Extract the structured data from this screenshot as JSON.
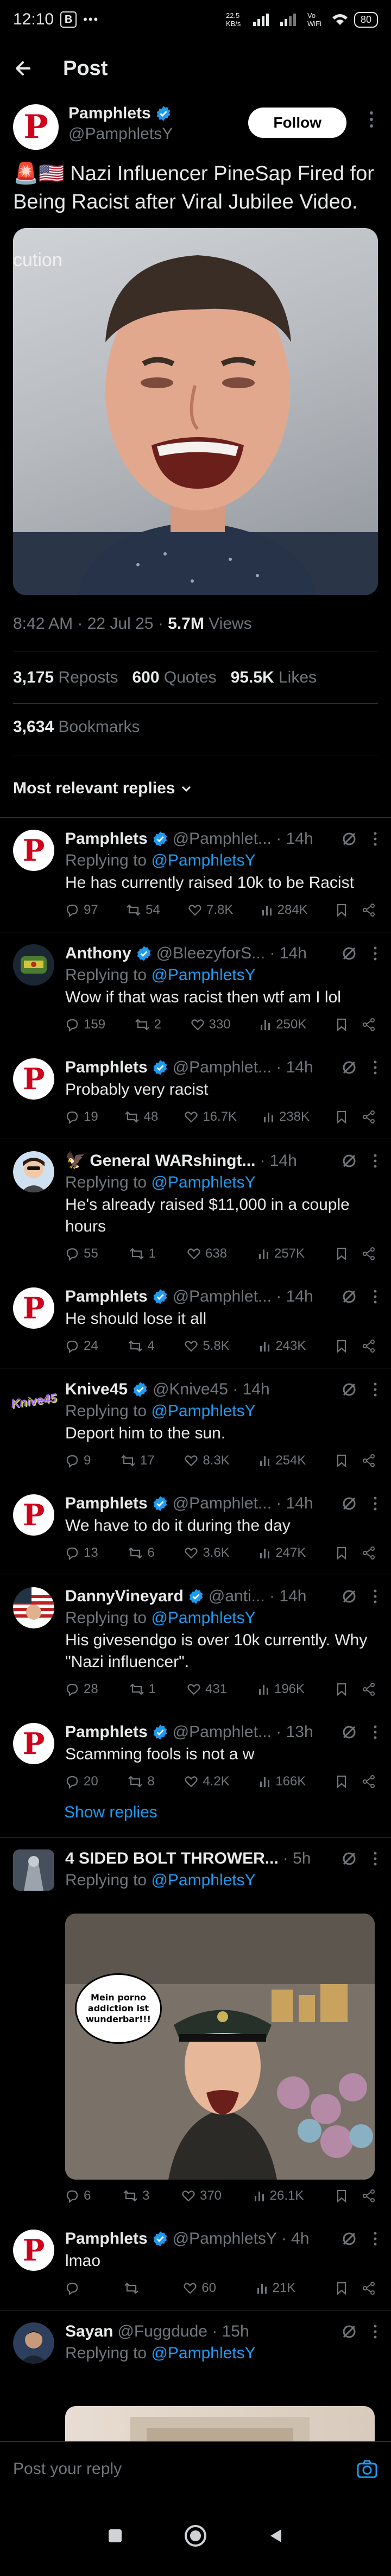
{
  "status_bar": {
    "time": "12:10",
    "speed": "22.5 KB/s",
    "network": "Vo WiFi",
    "battery": "80"
  },
  "header": {
    "title": "Post"
  },
  "post": {
    "author_name": "Pamphlets",
    "author_handle": "@PamphletsY",
    "follow_label": "Follow",
    "emoji": "🚨🇺🇸",
    "text": "Nazi Influencer PineSap Fired for Being Racist after Viral Jubilee Video.",
    "media_overlay_text": "cution",
    "time": "8:42 AM · 22 Jul 25 · ",
    "views_count": "5.7M",
    "views_label": " Views",
    "reposts_count": "3,175",
    "reposts_label": " Reposts",
    "quotes_count": "600",
    "quotes_label": " Quotes",
    "likes_count": "95.5K",
    "likes_label": " Likes",
    "bookmarks_count": "3,634",
    "bookmarks_label": " Bookmarks"
  },
  "sort_label": "Most relevant replies",
  "replies": [
    {
      "name": "Pamphlets",
      "rest": "@Pamphlet... · 14h",
      "replying_prefix": "Replying to ",
      "replying_to": "@PamphletsY",
      "text": "He has currently raised 10k to be Racist",
      "replies": "97",
      "reposts": "54",
      "likes": "7.8K",
      "views": "284K"
    },
    {
      "name": "Anthony",
      "rest": "@BleezyforS... · 14h",
      "replying_prefix": "Replying to ",
      "replying_to": "@PamphletsY",
      "text": "Wow if that was racist then wtf am I lol",
      "replies": "159",
      "reposts": "2",
      "likes": "330",
      "views": "250K"
    },
    {
      "name": "Pamphlets",
      "rest": "@Pamphlet... · 14h",
      "text": "Probably very racist",
      "replies": "19",
      "reposts": "48",
      "likes": "16.7K",
      "views": "238K"
    },
    {
      "name": "General WARshingt...",
      "rest": "· 14h",
      "emoji": "🦅",
      "replying_prefix": "Replying to ",
      "replying_to": "@PamphletsY",
      "text": "He's already raised $11,000 in a couple hours",
      "replies": "55",
      "reposts": "1",
      "likes": "638",
      "views": "257K"
    },
    {
      "name": "Pamphlets",
      "rest": "@Pamphlet... · 14h",
      "text": "He should lose it all",
      "replies": "24",
      "reposts": "4",
      "likes": "5.8K",
      "views": "243K"
    },
    {
      "name": "Knive45",
      "rest": "@Knive45 · 14h",
      "avatar_text": "Knive45",
      "replying_prefix": "Replying to ",
      "replying_to": "@PamphletsY",
      "text": "Deport him to the sun.",
      "replies": "9",
      "reposts": "17",
      "likes": "8.3K",
      "views": "254K"
    },
    {
      "name": "Pamphlets",
      "rest": "@Pamphlet... · 14h",
      "text": "We have to do it during the day",
      "replies": "13",
      "reposts": "6",
      "likes": "3.6K",
      "views": "247K"
    },
    {
      "name": "DannyVineyard",
      "rest": "@anti... · 14h",
      "replying_prefix": "Replying to ",
      "replying_to": "@PamphletsY",
      "text": "His givesendgo is over 10k currently. Why \"Nazi influencer\".",
      "replies": "28",
      "reposts": "1",
      "likes": "431",
      "views": "196K"
    },
    {
      "name": "Pamphlets",
      "rest": "@Pamphlet... · 13h",
      "text": "Scamming fools is not a w",
      "replies": "20",
      "reposts": "8",
      "likes": "4.2K",
      "views": "166K",
      "show_replies": "Show replies"
    },
    {
      "name": "4 SIDED BOLT THROWER...",
      "rest": "· 5h",
      "replying_prefix": "Replying to ",
      "replying_to": "@PamphletsY",
      "media_bubble": "Mein porno addiction ist wunderbar!!!",
      "replies": "6",
      "reposts": "3",
      "likes": "370",
      "views": "26.1K"
    },
    {
      "name": "Pamphlets",
      "rest": "@PamphletsY · 4h",
      "text": "lmao",
      "replies": "",
      "reposts": "",
      "likes": "60",
      "views": "21K"
    },
    {
      "name": "Sayan",
      "rest": "@Fuggdude · 15h",
      "replying_prefix": "Replying to ",
      "replying_to": "@PamphletsY"
    }
  ],
  "composer": {
    "placeholder": "Post your reply"
  },
  "colors": {
    "accent": "#1d9bf0",
    "background": "#000000",
    "muted": "#71767b",
    "brand_red": "#d0021b"
  }
}
